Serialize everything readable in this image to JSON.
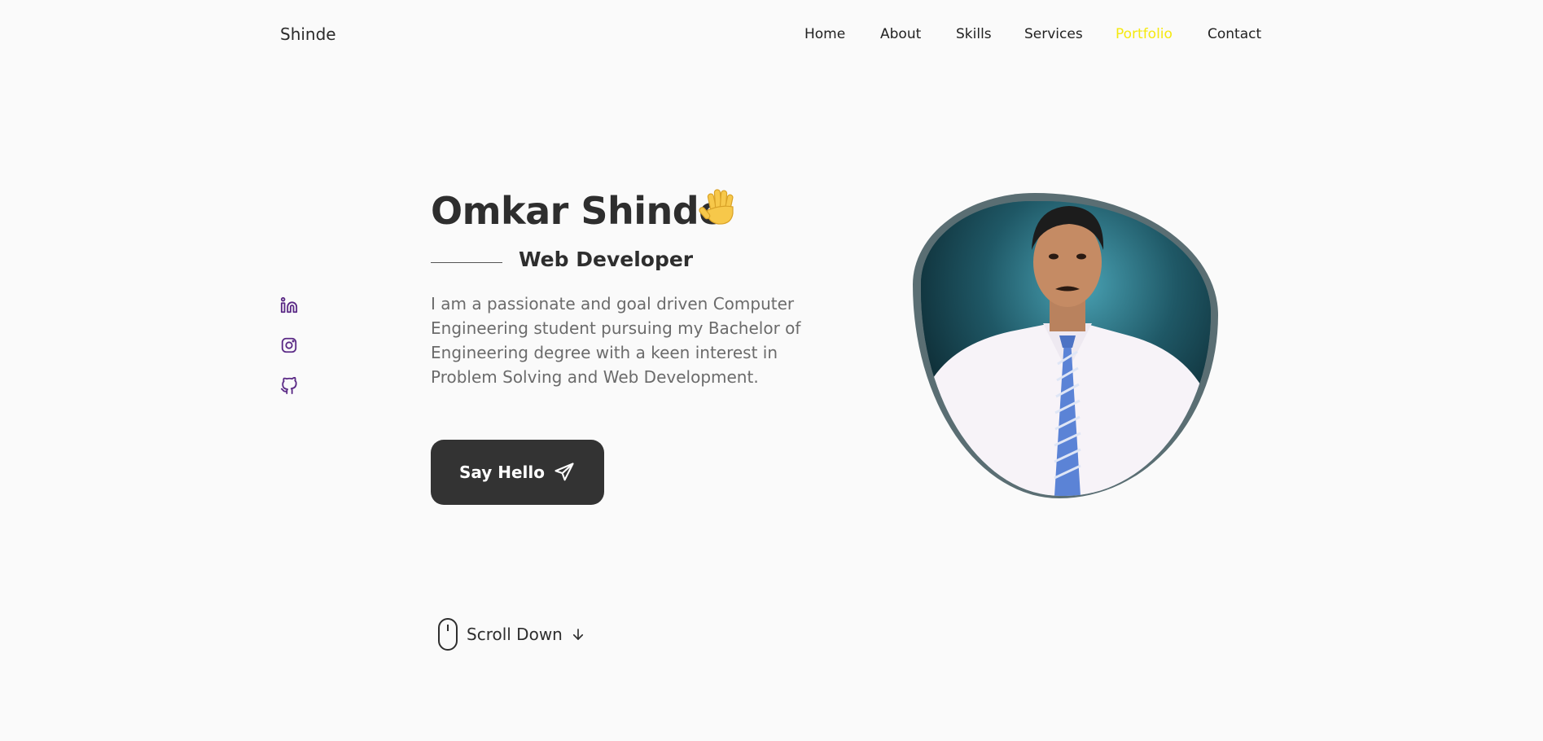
{
  "header": {
    "logo": "Shinde",
    "nav": [
      {
        "label": "Home",
        "active": false
      },
      {
        "label": "About",
        "active": false
      },
      {
        "label": "Skills",
        "active": false
      },
      {
        "label": "Services",
        "active": false
      },
      {
        "label": "Portfolio",
        "active": true
      },
      {
        "label": "Contact",
        "active": false
      }
    ]
  },
  "socials": [
    "linkedin-icon",
    "instagram-icon",
    "github-icon"
  ],
  "hero": {
    "name": "Omkar Shinde",
    "emoji": "raised-hand-icon",
    "role": "Web Developer",
    "description": "I am a passionate and goal driven Computer Engineering student pursuing my Bachelor of Engineering degree with a keen interest in Problem Solving and Web Development.",
    "cta_label": "Say Hello",
    "cta_icon": "paper-plane-icon"
  },
  "scroll": {
    "label": "Scroll Down",
    "icon": "mouse-icon",
    "arrow": "arrow-down-icon"
  },
  "colors": {
    "accent_active_nav": "#f5e90f",
    "button_bg": "#333333",
    "social_icon": "#5b2a86",
    "background": "#fafafa"
  }
}
